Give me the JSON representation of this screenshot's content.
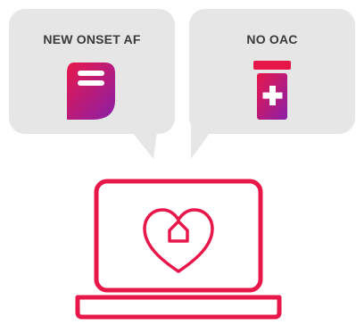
{
  "bubbles": [
    {
      "label": "NEW ONSET AF",
      "icon": "pacemaker-device-icon"
    },
    {
      "label": "NO OAC",
      "icon": "medicine-bottle-icon"
    }
  ],
  "laptop": {
    "icon": "laptop-heart-icon"
  },
  "colors": {
    "accent": "#e8174a",
    "gradient_start": "#e8174a",
    "gradient_end": "#8a1fa8",
    "bubble_bg": "#e6e6e6",
    "label_text": "#3a3a3a"
  }
}
